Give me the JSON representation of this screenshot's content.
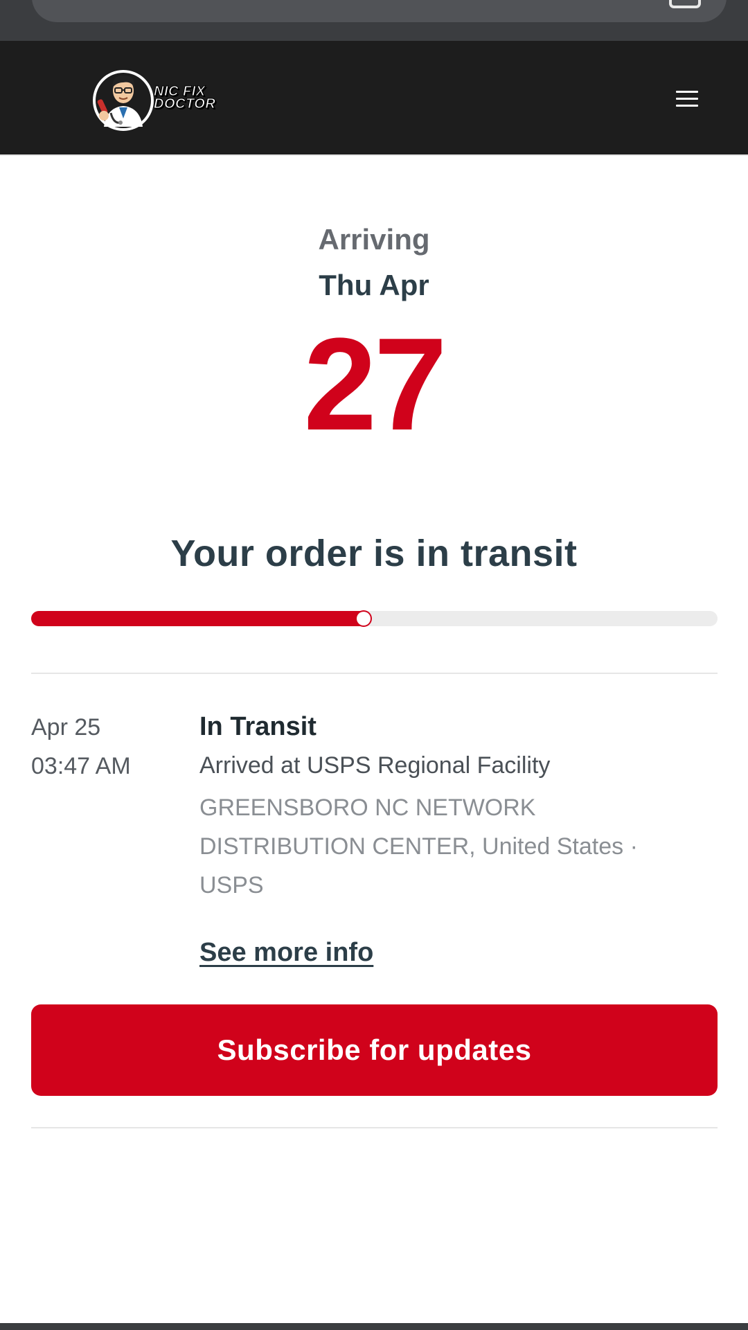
{
  "browser": {
    "icons": {
      "tabs": "tabs-icon"
    }
  },
  "header": {
    "logo_text_line1": "NIC FIX",
    "logo_text_line2": "DOCTOR",
    "icons": {
      "menu": "hamburger-menu-icon",
      "logo": "doctor-mascot-logo"
    }
  },
  "delivery": {
    "arriving_label": "Arriving",
    "weekday_month": "Thu Apr",
    "day": "27",
    "status_title": "Your order is in transit",
    "progress_fraction": 0.49
  },
  "event": {
    "date": "Apr 25",
    "time": "03:47 AM",
    "status": "In Transit",
    "description": "Arrived at USPS Regional Facility",
    "location": "GREENSBORO NC NETWORK DISTRIBUTION CENTER, United States · USPS",
    "see_more_label": "See more info"
  },
  "actions": {
    "subscribe_label": "Subscribe for updates"
  },
  "colors": {
    "accent": "#d0021b",
    "header_bg": "#1d1d1d",
    "heading_text": "#2c3e48"
  }
}
